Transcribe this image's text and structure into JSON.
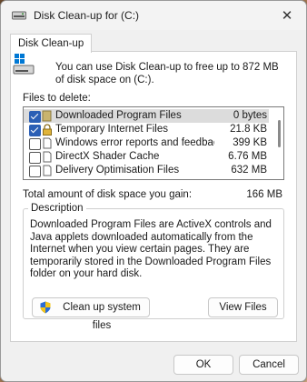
{
  "window": {
    "title": "Disk Clean-up for  (C:)"
  },
  "tab": {
    "label": "Disk Clean-up"
  },
  "info": {
    "text": "You can use Disk Clean-up to free up to 872 MB of disk space on  (C:)."
  },
  "files": {
    "label": "Files to delete:",
    "items": [
      {
        "name": "Downloaded Program Files",
        "size": "0 bytes",
        "checked": true,
        "selected": true
      },
      {
        "name": "Temporary Internet Files",
        "size": "21.8 KB",
        "checked": true,
        "selected": false
      },
      {
        "name": "Windows error reports and feedback di...",
        "size": "399 KB",
        "checked": false,
        "selected": false
      },
      {
        "name": "DirectX Shader Cache",
        "size": "6.76 MB",
        "checked": false,
        "selected": false
      },
      {
        "name": "Delivery Optimisation Files",
        "size": "632 MB",
        "checked": false,
        "selected": false
      }
    ]
  },
  "total": {
    "label": "Total amount of disk space you gain:",
    "value": "166 MB"
  },
  "description": {
    "legend": "Description",
    "text": "Downloaded Program Files are ActiveX controls and Java applets downloaded automatically from the Internet when you view certain pages. They are temporarily stored in the Downloaded Program Files folder on your hard disk."
  },
  "buttons": {
    "cleanup": "Clean up system files",
    "view": "View Files",
    "ok": "OK",
    "cancel": "Cancel"
  },
  "icons": {
    "title": "drive-icon",
    "close": "close-icon",
    "drive": "windows-drive-icon",
    "shield": "uac-shield-icon"
  }
}
